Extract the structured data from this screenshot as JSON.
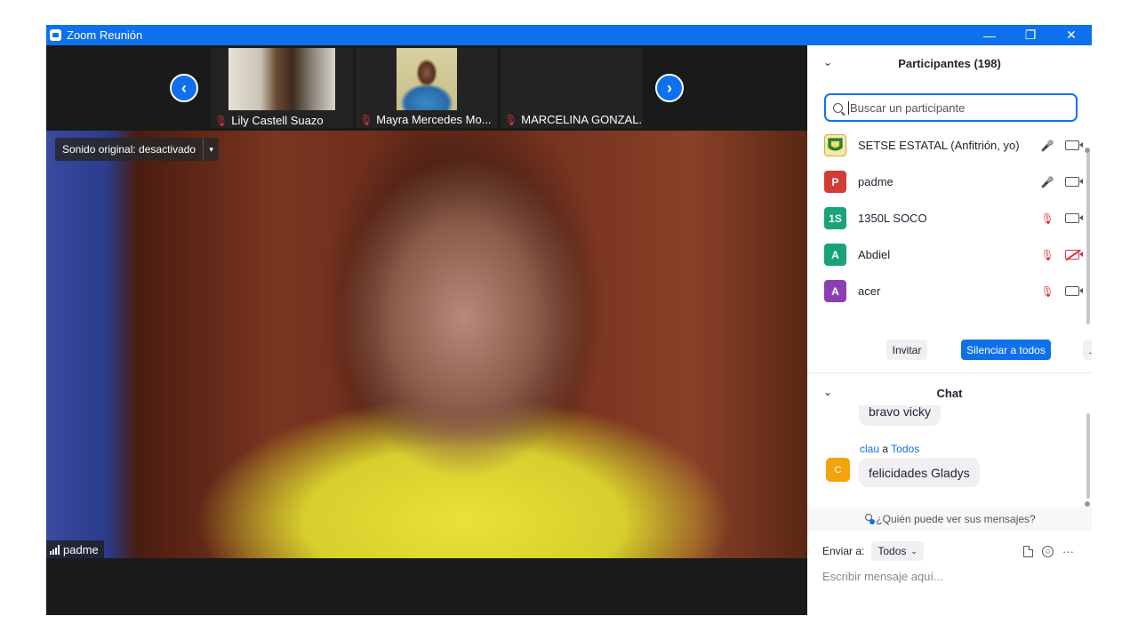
{
  "window": {
    "title": "Zoom Reunión",
    "minimize": "—",
    "restore": "❐",
    "close": "✕"
  },
  "strip": {
    "prev": "‹",
    "next": "›",
    "thumbnails": [
      {
        "name": "Lily Castell Suazo"
      },
      {
        "name": "Mayra Mercedes Mo..."
      },
      {
        "name": "MARCELINA GONZAL..."
      }
    ]
  },
  "main_video": {
    "sound_label": "Sonido original: desactivado",
    "dropdown_glyph": "▾",
    "speaker_name": "padme"
  },
  "participants": {
    "header": "Participantes (198)",
    "collapse_glyph": "⌄",
    "search_placeholder": "Buscar un participante",
    "list": [
      {
        "name": "SETSE ESTATAL (Anfitrión, yo)",
        "initials": "",
        "color": "#e8d24a",
        "mic": "on",
        "cam": "on"
      },
      {
        "name": "padme",
        "initials": "P",
        "color": "#d13d36",
        "mic": "on",
        "cam": "on"
      },
      {
        "name": "1350L SOCO",
        "initials": "1S",
        "color": "#1aa37a",
        "mic": "off",
        "cam": "on"
      },
      {
        "name": "Abdiel",
        "initials": "A",
        "color": "#1aa37a",
        "mic": "off",
        "cam": "off"
      },
      {
        "name": "acer",
        "initials": "A",
        "color": "#8b3fb6",
        "mic": "off",
        "cam": "on"
      }
    ],
    "invite": "Invitar",
    "mute_all": "Silenciar a todos",
    "more": "..."
  },
  "chat": {
    "header": "Chat",
    "collapse_glyph": "⌄",
    "messages": [
      {
        "text": "bravo vicky"
      },
      {
        "sender": "clau",
        "connector": "a",
        "recipient": "Todos",
        "avatar": "C",
        "text": "felicidades Gladys"
      }
    ],
    "who_sees": "¿Quién puede ver sus mensajes?",
    "send_to_label": "Enviar a:",
    "send_to_value": "Todos",
    "send_to_caret": "⌄",
    "more_glyph": "···",
    "emoji_glyph": "☺",
    "compose_placeholder": "Escribir mensaje aquí..."
  }
}
